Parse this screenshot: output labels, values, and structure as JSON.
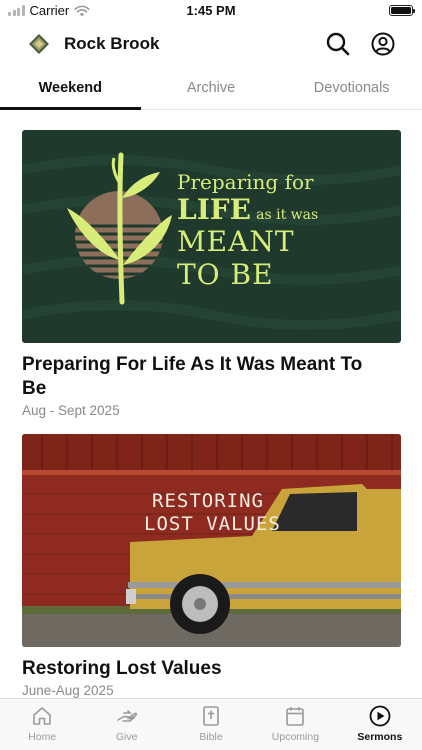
{
  "status_bar": {
    "carrier": "Carrier",
    "time": "1:45 PM"
  },
  "header": {
    "title": "Rock Brook"
  },
  "tabs": [
    {
      "label": "Weekend",
      "active": true
    },
    {
      "label": "Archive",
      "active": false
    },
    {
      "label": "Devotionals",
      "active": false
    }
  ],
  "sermons": [
    {
      "title": "Preparing For Life As It Was Meant To Be",
      "date": "Aug - Sept 2025",
      "artwork": {
        "line1": "Preparing for",
        "line2_big": "LIFE",
        "line2_small": "as it was",
        "line3": "MEANT",
        "line4": "TO BE"
      }
    },
    {
      "title": "Restoring Lost Values",
      "date": "June-Aug 2025",
      "artwork": {
        "line1": "RESTORING",
        "line2": "LOST VALUES"
      }
    }
  ],
  "bottom_nav": [
    {
      "label": "Home",
      "icon": "home-icon",
      "active": false
    },
    {
      "label": "Give",
      "icon": "give-hand-icon",
      "active": false
    },
    {
      "label": "Bible",
      "icon": "bible-icon",
      "active": false
    },
    {
      "label": "Upcoming",
      "icon": "calendar-icon",
      "active": false
    },
    {
      "label": "Sermons",
      "icon": "play-circle-icon",
      "active": true
    }
  ],
  "colors": {
    "accent": "#111111",
    "inactive": "#8a8a8a",
    "card1_bg": "#1f3a2c",
    "card1_text": "#d8ec7a",
    "truck_yellow": "#c9a43a",
    "barn_red": "#8e2a1f"
  }
}
